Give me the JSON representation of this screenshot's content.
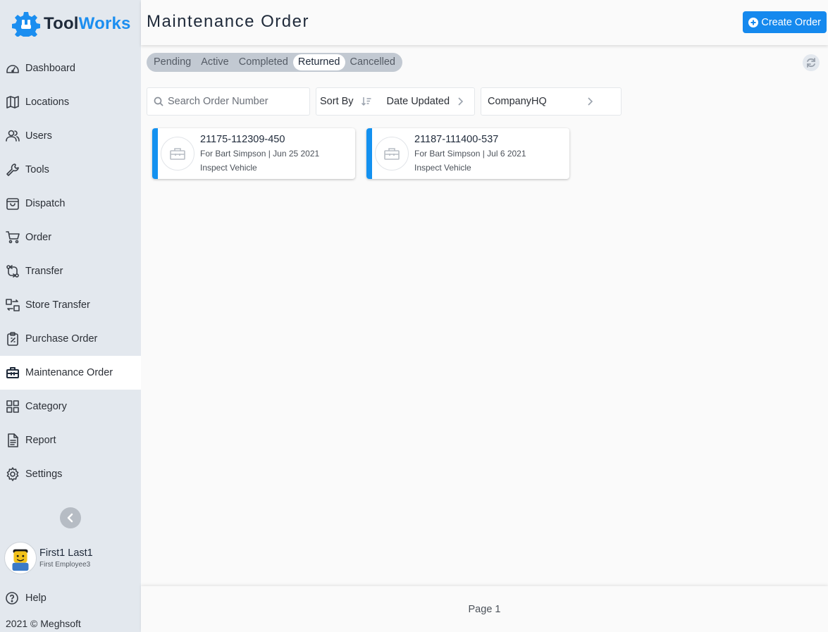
{
  "app": {
    "logo_tool": "Tool",
    "logo_works": "Works"
  },
  "sidebar": {
    "items": [
      {
        "label": "Dashboard",
        "icon": "dashboard-icon"
      },
      {
        "label": "Locations",
        "icon": "map-icon"
      },
      {
        "label": "Users",
        "icon": "users-icon"
      },
      {
        "label": "Tools",
        "icon": "wrench-icon"
      },
      {
        "label": "Dispatch",
        "icon": "bag-icon"
      },
      {
        "label": "Order",
        "icon": "cart-icon"
      },
      {
        "label": "Transfer",
        "icon": "transfer-icon"
      },
      {
        "label": "Store Transfer",
        "icon": "store-transfer-icon"
      },
      {
        "label": "Purchase Order",
        "icon": "clipboard-icon"
      },
      {
        "label": "Maintenance Order",
        "icon": "toolbox-icon",
        "active": true
      },
      {
        "label": "Category",
        "icon": "grid-icon"
      },
      {
        "label": "Report",
        "icon": "document-icon"
      },
      {
        "label": "Settings",
        "icon": "gear-icon"
      }
    ],
    "user": {
      "name": "First1 Last1",
      "role": "First Employee3"
    },
    "help_label": "Help",
    "copyright": "2021 © Meghsoft"
  },
  "header": {
    "title": "Maintenance Order",
    "create_label": "Create Order"
  },
  "tabs": [
    {
      "label": "Pending"
    },
    {
      "label": "Active"
    },
    {
      "label": "Completed"
    },
    {
      "label": "Returned",
      "active": true
    },
    {
      "label": "Cancelled"
    }
  ],
  "filters": {
    "search_placeholder": "Search Order Number",
    "sort_label": "Sort By",
    "sort_value": "Date Updated",
    "location_value": "CompanyHQ"
  },
  "orders": [
    {
      "number": "21175-112309-450",
      "subtitle": "For Bart Simpson | Jun 25 2021",
      "task": "Inspect Vehicle"
    },
    {
      "number": "21187-111400-537",
      "subtitle": "For Bart Simpson | Jul 6 2021",
      "task": "Inspect Vehicle"
    }
  ],
  "footer": {
    "page_label": "Page 1"
  },
  "colors": {
    "accent": "#1589ee",
    "sidebar_bg": "#e3e8ee",
    "card_stripe": "#1391f0"
  }
}
